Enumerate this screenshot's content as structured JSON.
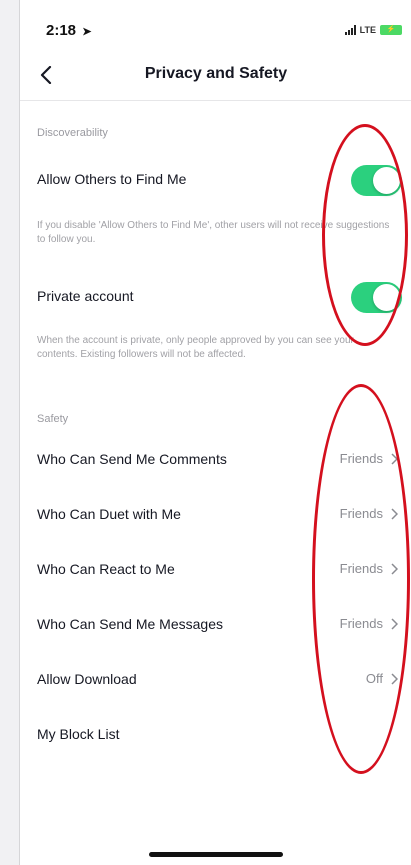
{
  "status_bar": {
    "time": "2:18",
    "location_icon": "location-arrow-icon",
    "network": "LTE",
    "battery_icon": "battery-charging-icon"
  },
  "nav": {
    "back_icon": "chevron-left-icon",
    "title": "Privacy and Safety"
  },
  "discoverability": {
    "header": "Discoverability",
    "allow_find": {
      "label": "Allow Others to Find Me",
      "enabled": true,
      "description": "If you disable 'Allow Others to Find Me', other users will not receive suggestions to follow you."
    },
    "private_account": {
      "label": "Private account",
      "enabled": true,
      "description": "When the account is private, only people approved by you can see your contents. Existing followers will not be affected."
    }
  },
  "safety": {
    "header": "Safety",
    "items": [
      {
        "label": "Who Can Send Me Comments",
        "value": "Friends"
      },
      {
        "label": "Who Can Duet with Me",
        "value": "Friends"
      },
      {
        "label": "Who Can React to Me",
        "value": "Friends"
      },
      {
        "label": "Who Can Send Me Messages",
        "value": "Friends"
      },
      {
        "label": "Allow Download",
        "value": "Off"
      },
      {
        "label": "My Block List",
        "value": ""
      }
    ]
  },
  "colors": {
    "toggle_on": "#2bd07e",
    "annotation": "#d4101e",
    "secondary_text": "#8a8b91"
  }
}
